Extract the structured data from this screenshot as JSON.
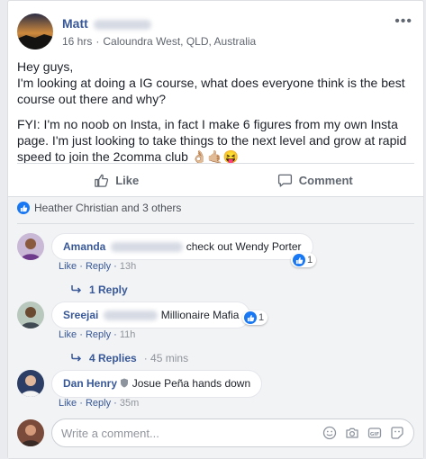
{
  "post": {
    "author_first": "Matt",
    "time": "16 hrs",
    "location": "Caloundra West, QLD, Australia",
    "more_icon": "ellipsis-icon",
    "paragraphs": [
      "Hey guys,\nI'm looking at doing a IG course, what does everyone think is the best course out there and why?",
      "FYI: I'm no noob on Insta, in fact I make 6 figures from my own Insta page. I'm just looking to take things to the next level and grow at rapid speed to join the 2comma club 👌🏼🤙🏼😝"
    ]
  },
  "actions": {
    "like_label": "Like",
    "comment_label": "Comment"
  },
  "reactions": {
    "summary": "Heather Christian and 3 others"
  },
  "comments": [
    {
      "name_first": "Amanda",
      "text": "check out Wendy Porter",
      "reaction_count": "1",
      "like": "Like",
      "reply": "Reply",
      "time": "13h",
      "replies_label": "1 Reply",
      "replies_time": ""
    },
    {
      "name_first": "Sreejai",
      "text": "Millionaire Mafia",
      "reaction_count": "1",
      "like": "Like",
      "reply": "Reply",
      "time": "11h",
      "replies_label": "4 Replies",
      "replies_time": "45 mins"
    },
    {
      "name_first": "Dan Henry",
      "text": "Josue Peña hands down",
      "reaction_count": "",
      "like": "Like",
      "reply": "Reply",
      "time": "35m",
      "replies_label": "",
      "replies_time": ""
    }
  ],
  "composer": {
    "placeholder": "Write a comment..."
  },
  "colors": {
    "link": "#385898",
    "like_blue": "#1877f2",
    "gray_bg": "#f2f3f5"
  }
}
